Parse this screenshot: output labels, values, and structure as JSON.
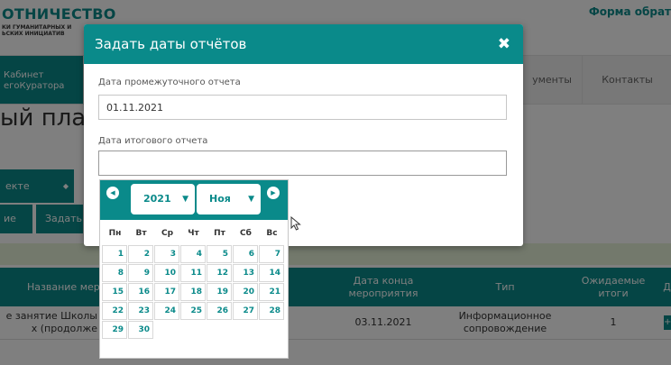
{
  "background": {
    "brand_title": "ОТНИЧЕСТВО",
    "brand_subtitle": "КИ ГУМАНИТАРНЫХ И ЬСКИХ ИНИЦИАТИВ",
    "top_link": "Форма обрат",
    "nav_cabinet": "Кабинет егоКуратора",
    "nav_docs": "ументы",
    "nav_contacts": "Контакты",
    "page_title": "ый план",
    "project_select": "екте",
    "btn_a": "ие",
    "btn_b": "Задать",
    "table": {
      "headers": [
        "Название мер",
        "Дата конца мероприятия",
        "Тип",
        "Ожидаемые итоги",
        "Д"
      ],
      "row": {
        "name": "е занятие Школы х (продолже",
        "end_date": "03.11.2021",
        "type": "Информационное сопровождение",
        "results": "1",
        "action": "+"
      }
    }
  },
  "modal": {
    "title": "Задать даты отчётов",
    "close_icon": "close-icon",
    "interim_label": "Дата промежуточного отчета",
    "interim_value": "01.11.2021",
    "final_label": "Дата итогового отчета",
    "final_value": ""
  },
  "datepicker": {
    "prev_icon": "chevron-left-icon",
    "next_icon": "chevron-right-icon",
    "year": "2021",
    "month": "Ноя",
    "weekdays": [
      "Пн",
      "Вт",
      "Ср",
      "Чт",
      "Пт",
      "Сб",
      "Вс"
    ],
    "first_weekday_offset": 0,
    "days": [
      "1",
      "2",
      "3",
      "4",
      "5",
      "6",
      "7",
      "8",
      "9",
      "10",
      "11",
      "12",
      "13",
      "14",
      "15",
      "16",
      "17",
      "18",
      "19",
      "20",
      "21",
      "22",
      "23",
      "24",
      "25",
      "26",
      "27",
      "28",
      "29",
      "30"
    ]
  },
  "colors": {
    "accent": "#0a8a8a",
    "overlay": "rgba(0,0,0,0.5)",
    "green_band": "#e6f2d9"
  }
}
